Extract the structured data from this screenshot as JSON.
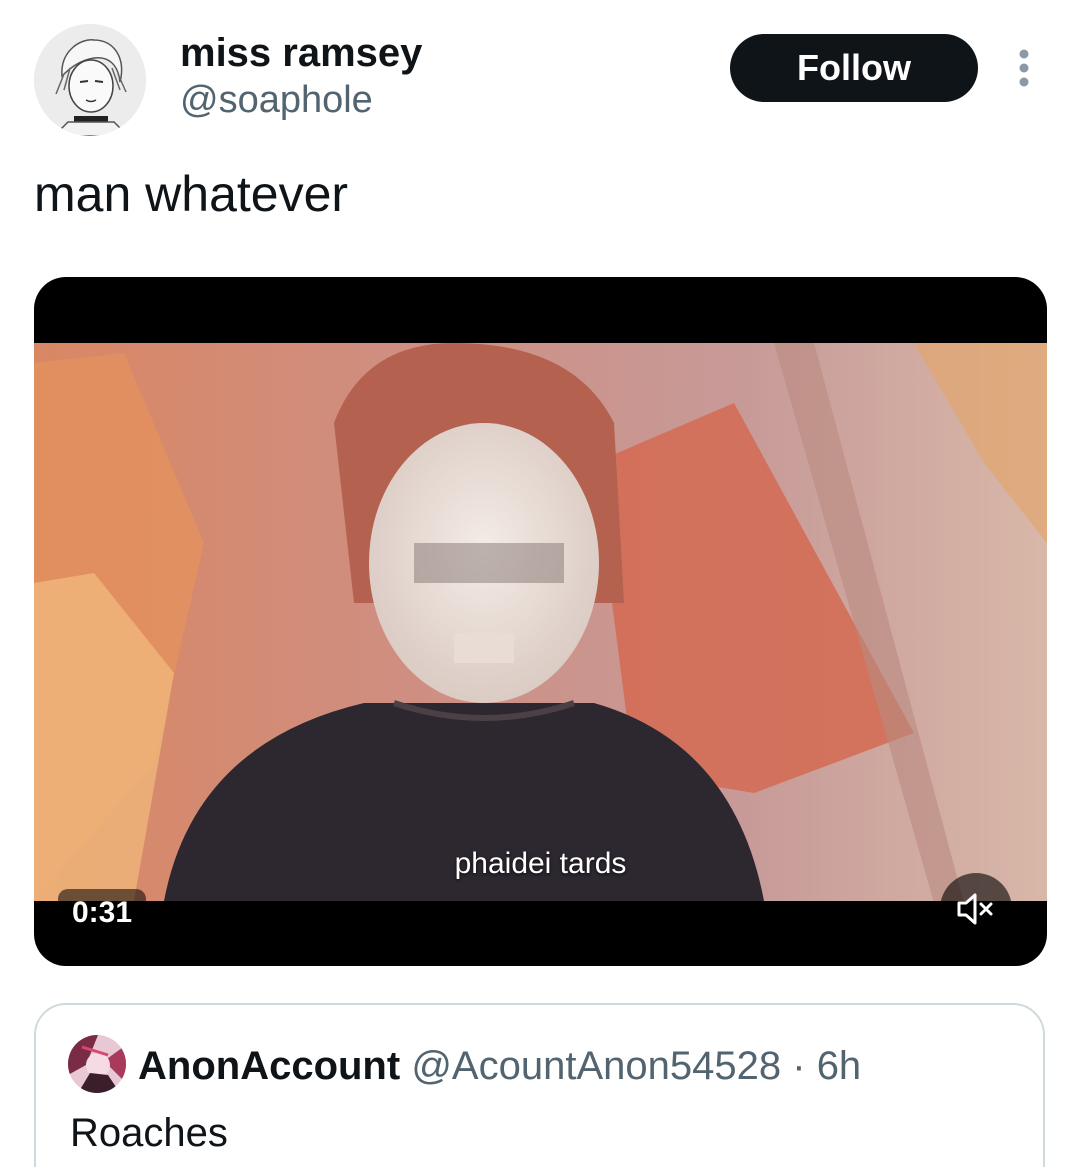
{
  "post": {
    "author": {
      "display_name": "miss ramsey",
      "handle": "@soaphole"
    },
    "follow_label": "Follow",
    "text": "man whatever"
  },
  "video": {
    "subtitle": "phaidei tards",
    "duration": "0:31",
    "muted": true
  },
  "quoted_post": {
    "display_name": "AnonAccount",
    "handle": "@AcountAnon54528",
    "separator": "·",
    "time": "6h",
    "text": "Roaches"
  },
  "colors": {
    "text_primary": "#0f1419",
    "text_secondary": "#536471",
    "button_bg": "#0f1419",
    "border": "#cfd9de"
  },
  "icons": {
    "more": "more-vertical-icon",
    "mute": "volume-muted-icon"
  }
}
